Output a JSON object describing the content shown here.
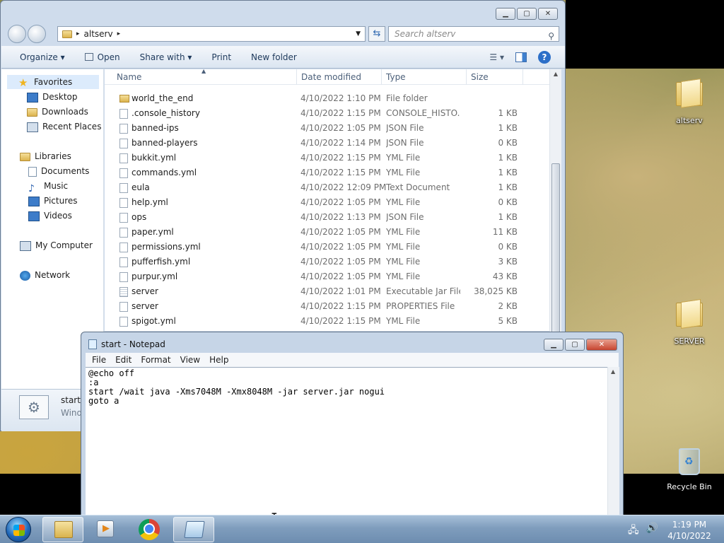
{
  "desktop": {
    "icons": [
      {
        "label": "altserv"
      },
      {
        "label": "SERVER"
      },
      {
        "label": "Recycle Bin"
      }
    ]
  },
  "explorer": {
    "address": {
      "path": "altserv",
      "sep1": "▸",
      "sep2": "▸"
    },
    "search": {
      "placeholder": "Search altserv"
    },
    "toolbar": {
      "organize": "Organize ▾",
      "open": "Open",
      "share_with": "Share with ▾",
      "print": "Print",
      "new_folder": "New folder"
    },
    "nav": {
      "favorites": "Favorites",
      "desktop": "Desktop",
      "downloads": "Downloads",
      "recent_places": "Recent Places",
      "libraries": "Libraries",
      "documents": "Documents",
      "music": "Music",
      "pictures": "Pictures",
      "videos": "Videos",
      "my_computer": "My Computer",
      "network": "Network"
    },
    "columns": {
      "name": "Name",
      "date": "Date modified",
      "type": "Type",
      "size": "Size"
    },
    "files": [
      {
        "name": "world_the_end",
        "date": "4/10/2022 1:10 PM",
        "type": "File folder",
        "size": ""
      },
      {
        "name": ".console_history",
        "date": "4/10/2022 1:15 PM",
        "type": "CONSOLE_HISTO...",
        "size": "1 KB"
      },
      {
        "name": "banned-ips",
        "date": "4/10/2022 1:05 PM",
        "type": "JSON File",
        "size": "1 KB"
      },
      {
        "name": "banned-players",
        "date": "4/10/2022 1:14 PM",
        "type": "JSON File",
        "size": "0 KB"
      },
      {
        "name": "bukkit.yml",
        "date": "4/10/2022 1:15 PM",
        "type": "YML File",
        "size": "1 KB"
      },
      {
        "name": "commands.yml",
        "date": "4/10/2022 1:15 PM",
        "type": "YML File",
        "size": "1 KB"
      },
      {
        "name": "eula",
        "date": "4/10/2022 12:09 PM",
        "type": "Text Document",
        "size": "1 KB"
      },
      {
        "name": "help.yml",
        "date": "4/10/2022 1:05 PM",
        "type": "YML File",
        "size": "0 KB"
      },
      {
        "name": "ops",
        "date": "4/10/2022 1:13 PM",
        "type": "JSON File",
        "size": "1 KB"
      },
      {
        "name": "paper.yml",
        "date": "4/10/2022 1:05 PM",
        "type": "YML File",
        "size": "11 KB"
      },
      {
        "name": "permissions.yml",
        "date": "4/10/2022 1:05 PM",
        "type": "YML File",
        "size": "0 KB"
      },
      {
        "name": "pufferfish.yml",
        "date": "4/10/2022 1:05 PM",
        "type": "YML File",
        "size": "3 KB"
      },
      {
        "name": "purpur.yml",
        "date": "4/10/2022 1:05 PM",
        "type": "YML File",
        "size": "43 KB"
      },
      {
        "name": "server",
        "date": "4/10/2022 1:01 PM",
        "type": "Executable Jar File",
        "size": "38,025 KB"
      },
      {
        "name": "server",
        "date": "4/10/2022 1:15 PM",
        "type": "PROPERTIES File",
        "size": "2 KB"
      },
      {
        "name": "spigot.yml",
        "date": "4/10/2022 1:15 PM",
        "type": "YML File",
        "size": "5 KB"
      }
    ],
    "details": {
      "name": "start",
      "type": "Wind"
    }
  },
  "notepad": {
    "title": "start - Notepad",
    "menu": {
      "file": "File",
      "edit": "Edit",
      "format": "Format",
      "view": "View",
      "help": "Help"
    },
    "lines": [
      "@echo off",
      ":a",
      "start /wait java -Xms7048M -Xmx8048M -jar server.jar nogui",
      "goto a"
    ]
  },
  "taskbar": {
    "time": "1:19 PM",
    "date": "4/10/2022"
  }
}
